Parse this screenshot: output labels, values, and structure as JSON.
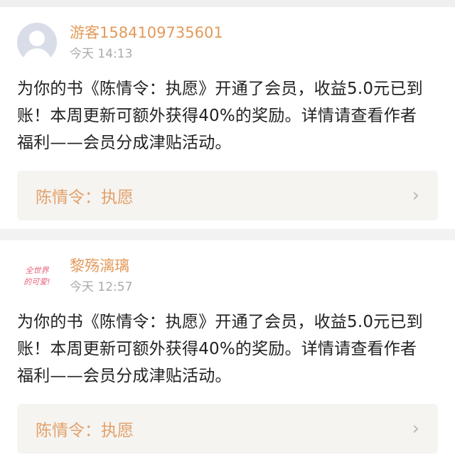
{
  "notifications": [
    {
      "username": "游客1584109735601",
      "time": "今天 14:13",
      "avatar": "default-user-icon",
      "message": "为你的书《陈情令：执愿》开通了会员，收益5.0元已到账！本周更新可额外获得40%的奖励。详情请查看作者福利——会员分成津贴活动。",
      "book_title": "陈情令：执愿"
    },
    {
      "username": "黎殇漓璃",
      "time": "今天 12:57",
      "avatar": "handwritten-logo-avatar",
      "avatar_text": "全世界的可爱!",
      "message": "为你的书《陈情令：执愿》开通了会员，收益5.0元已到账！本周更新可额外获得40%的奖励。详情请查看作者福利——会员分成津贴活动。",
      "book_title": "陈情令：执愿"
    }
  ],
  "colors": {
    "username": "#e39a5a",
    "book_title": "#e3a06a",
    "timestamp": "#aaaaaa",
    "book_bg": "#f5f4f0"
  }
}
